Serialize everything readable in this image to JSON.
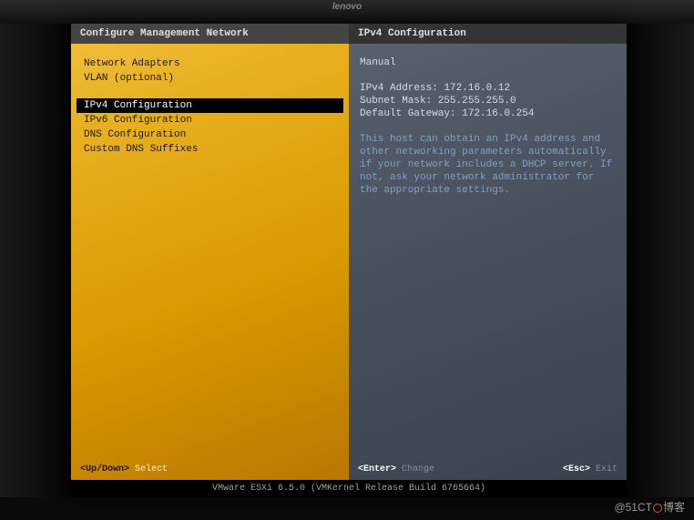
{
  "brand": "lenovo",
  "left": {
    "title": "Configure Management Network",
    "group1": [
      "Network Adapters",
      "VLAN (optional)"
    ],
    "group2": [
      "IPv4 Configuration",
      "IPv6 Configuration",
      "DNS Configuration",
      "Custom DNS Suffixes"
    ],
    "selected_index": 0,
    "footer_key": "<Up/Down>",
    "footer_action": "Select"
  },
  "right": {
    "title": "IPv4 Configuration",
    "mode": "Manual",
    "ipv4_label": "IPv4 Address:",
    "ipv4_value": "172.16.0.12",
    "mask_label": "Subnet Mask:",
    "mask_value": "255.255.255.0",
    "gw_label": "Default Gateway:",
    "gw_value": "172.16.0.254",
    "description": "This host can obtain an IPv4 address and other networking parameters automatically if your network includes a DHCP server. If not, ask your network administrator for the appropriate settings.",
    "footer_left_key": "<Enter>",
    "footer_left_action": "Change",
    "footer_right_key": "<Esc>",
    "footer_right_action": "Exit"
  },
  "bottom": "VMware ESXi 6.5.0 (VMKernel Release Build 6765664)",
  "watermark": "@51CT  博客"
}
